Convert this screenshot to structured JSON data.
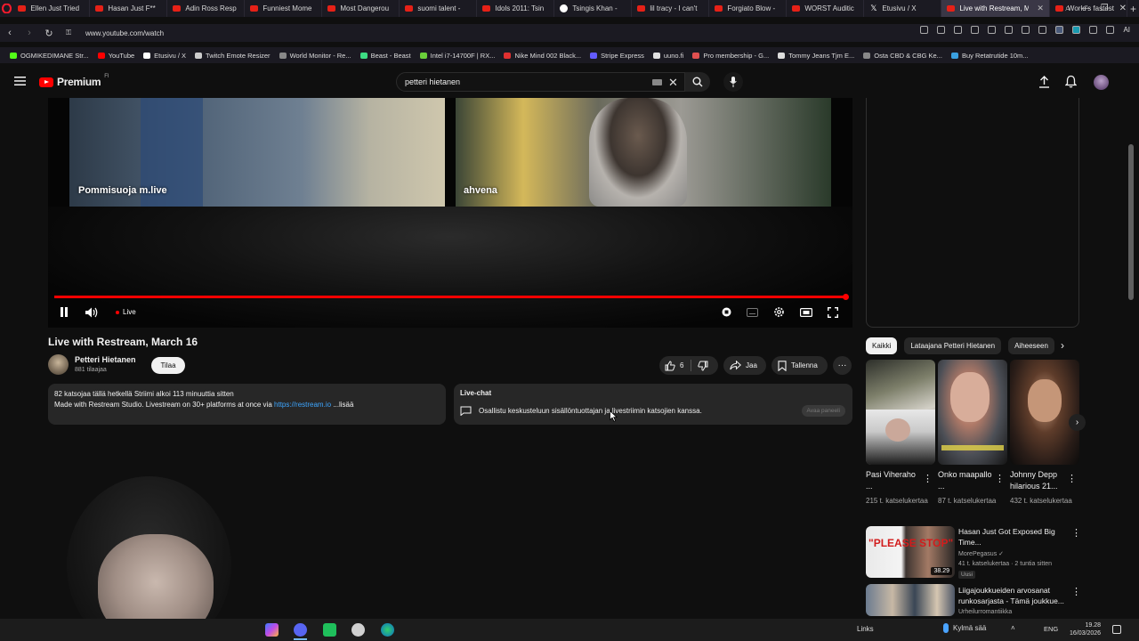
{
  "browser": {
    "tabs": [
      {
        "label": "Ellen Just Tried",
        "icon": "youtube-icon"
      },
      {
        "label": "Hasan Just F**",
        "icon": "youtube-icon"
      },
      {
        "label": "Adin Ross Resp",
        "icon": "youtube-icon"
      },
      {
        "label": "Funniest Mome",
        "icon": "youtube-icon"
      },
      {
        "label": "Most Dangerou",
        "icon": "youtube-icon"
      },
      {
        "label": "suomi talent -",
        "icon": "youtube-icon"
      },
      {
        "label": "Idols 2011: Tsin",
        "icon": "youtube-icon"
      },
      {
        "label": "Tsingis Khan -",
        "icon": "google-icon"
      },
      {
        "label": "lil tracy - I can't",
        "icon": "youtube-icon"
      },
      {
        "label": "Forgiato Blow -",
        "icon": "youtube-icon"
      },
      {
        "label": "WORST Auditic",
        "icon": "youtube-icon"
      },
      {
        "label": "Etusivu / X",
        "icon": "x-icon"
      },
      {
        "label": "Live with Restream, M",
        "icon": "youtube-icon",
        "active": true
      },
      {
        "label": "World's fastest",
        "icon": "youtube-icon"
      }
    ],
    "url": "www.youtube.com/watch",
    "ai_label": "AI",
    "bookmarks": [
      {
        "label": "OGMIKEDIMANE Str...",
        "color": "#53fc18"
      },
      {
        "label": "YouTube",
        "color": "#ff0000"
      },
      {
        "label": "Etusivu / X",
        "color": "#ffffff"
      },
      {
        "label": "Twitch Emote Resizer",
        "color": "#cccccc"
      },
      {
        "label": "World Monitor - Re...",
        "color": "#888888"
      },
      {
        "label": "Beast - Beast",
        "color": "#3ddc84"
      },
      {
        "label": "Intel i7-14700F | RX...",
        "color": "#6bcf3a"
      },
      {
        "label": "Nike Mind 002 Black...",
        "color": "#e03030"
      },
      {
        "label": "Stripe Express",
        "color": "#635bff"
      },
      {
        "label": "uuno.fi",
        "color": "#e0e0e0"
      },
      {
        "label": "Pro membership - G...",
        "color": "#e05050"
      },
      {
        "label": "Tommy Jeans Tjm E...",
        "color": "#dddddd"
      },
      {
        "label": "Osta CBD & CBG Ke...",
        "color": "#888888"
      },
      {
        "label": "Buy Retatrutide 10m...",
        "color": "#3aa0e0"
      }
    ]
  },
  "youtube": {
    "logo_text": "Premium",
    "logo_country": "FI",
    "search_value": "petteri hietanen"
  },
  "player": {
    "left_cam_label": "Pommisuoja m.live",
    "right_cam_label": "ahvena",
    "live_label": "Live",
    "progress_fraction": 1.0
  },
  "video": {
    "title": "Live with Restream, March 16",
    "channel_name": "Petteri Hietanen",
    "subscribers": "881 tilaajaa",
    "subscribe_label": "Tilaa",
    "like_count": "6",
    "share_label": "Jaa",
    "save_label": "Tallenna",
    "description_stats": "82 katsojaa tällä hetkellä  Striimi alkoi 113 minuuttia sitten",
    "description_text": "Made with Restream Studio. Livestream on 30+ platforms at once via ",
    "description_link": "https://restream.io",
    "description_more": " ...lisää"
  },
  "livechat": {
    "title": "Live-chat",
    "text": "Osallistu keskusteluun sisällöntuottajan ja livestriimin katsojien kanssa.",
    "open_panel": "Avaa paneeli"
  },
  "sidebar": {
    "chips": [
      {
        "label": "Kaikki",
        "active": true
      },
      {
        "label": "Lataajana Petteri Hietanen"
      },
      {
        "label": "Aiheeseen"
      }
    ],
    "shorts": [
      {
        "title": "Pasi Viheraho ...",
        "views": "215 t. katselukertaa"
      },
      {
        "title": "Onko maapallo ...",
        "views": "87 t. katselukertaa"
      },
      {
        "title": "Johnny Depp hilarious 21...",
        "views": "432 t. katselukertaa"
      }
    ],
    "recommendations": [
      {
        "title": "Hasan Just Got Exposed Big Time...",
        "channel": "MorePegasus",
        "meta": "41 t. katselukertaa · 2 tuntia sitten",
        "badge": "Uusi",
        "thumb_text": "\"PLEASE STOP\"",
        "duration": "38.29"
      },
      {
        "title": "Liigajoukkueiden arvosanat runkosarjasta - Tämä joukkue...",
        "channel": "Urheilurromantiikka"
      }
    ]
  },
  "taskbar": {
    "links_label": "Links",
    "weather": "Kylmä sää",
    "lang": "ENG",
    "time": "19.28",
    "date": "16/03/2026"
  }
}
